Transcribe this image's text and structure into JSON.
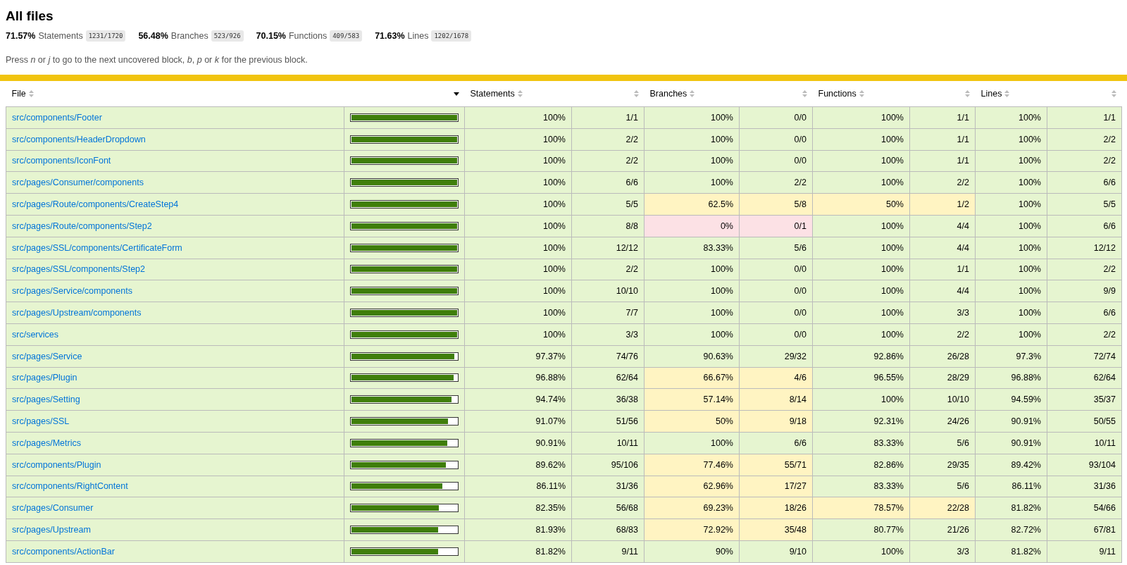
{
  "title": "All files",
  "summary": [
    {
      "pct": "71.57%",
      "label": "Statements",
      "fraction": "1231/1720"
    },
    {
      "pct": "56.48%",
      "label": "Branches",
      "fraction": "523/926"
    },
    {
      "pct": "70.15%",
      "label": "Functions",
      "fraction": "409/583"
    },
    {
      "pct": "71.63%",
      "label": "Lines",
      "fraction": "1202/1678"
    }
  ],
  "help": "Press *n* or *j* to go to the next uncovered block, *b*, *p* or *k* for the previous block.",
  "columns": [
    {
      "label": "File",
      "sorted": false
    },
    {
      "sorted": true
    },
    {
      "label": "Statements",
      "sorted": false
    },
    {
      "sorted": false
    },
    {
      "label": "Branches",
      "sorted": false
    },
    {
      "sorted": false
    },
    {
      "label": "Functions",
      "sorted": false
    },
    {
      "sorted": false
    },
    {
      "label": "Lines",
      "sorted": false
    },
    {
      "sorted": false
    }
  ],
  "rows": [
    {
      "file": "src/components/Footer",
      "level": 1,
      "statements": {
        "pct": "100%",
        "fraction": "1/1",
        "color": "#e6f5d0"
      },
      "branches": {
        "pct": "100%",
        "fraction": "0/0",
        "color": "#e6f5d0"
      },
      "functions": {
        "pct": "100%",
        "fraction": "1/1",
        "color": "#e6f5d0"
      },
      "lines": {
        "pct": "100%",
        "fraction": "1/1",
        "color": "#e6f5d0"
      }
    },
    {
      "file": "src/components/HeaderDropdown",
      "level": 1,
      "statements": {
        "pct": "100%",
        "fraction": "2/2",
        "color": "#e6f5d0"
      },
      "branches": {
        "pct": "100%",
        "fraction": "0/0",
        "color": "#e6f5d0"
      },
      "functions": {
        "pct": "100%",
        "fraction": "1/1",
        "color": "#e6f5d0"
      },
      "lines": {
        "pct": "100%",
        "fraction": "2/2",
        "color": "#e6f5d0"
      }
    },
    {
      "file": "src/components/IconFont",
      "level": 1,
      "statements": {
        "pct": "100%",
        "fraction": "2/2",
        "color": "#e6f5d0"
      },
      "branches": {
        "pct": "100%",
        "fraction": "0/0",
        "color": "#e6f5d0"
      },
      "functions": {
        "pct": "100%",
        "fraction": "1/1",
        "color": "#e6f5d0"
      },
      "lines": {
        "pct": "100%",
        "fraction": "2/2",
        "color": "#e6f5d0"
      }
    },
    {
      "file": "src/pages/Consumer/components",
      "level": 1,
      "statements": {
        "pct": "100%",
        "fraction": "6/6",
        "color": "#e6f5d0"
      },
      "branches": {
        "pct": "100%",
        "fraction": "2/2",
        "color": "#e6f5d0"
      },
      "functions": {
        "pct": "100%",
        "fraction": "2/2",
        "color": "#e6f5d0"
      },
      "lines": {
        "pct": "100%",
        "fraction": "6/6",
        "color": "#e6f5d0"
      }
    },
    {
      "file": "src/pages/Route/components/CreateStep4",
      "level": 1,
      "statements": {
        "pct": "100%",
        "fraction": "5/5",
        "color": "#e6f5d0"
      },
      "branches": {
        "pct": "62.5%",
        "fraction": "5/8",
        "color": "#fff4c2"
      },
      "functions": {
        "pct": "50%",
        "fraction": "1/2",
        "color": "#fff4c2"
      },
      "lines": {
        "pct": "100%",
        "fraction": "5/5",
        "color": "#e6f5d0"
      }
    },
    {
      "file": "src/pages/Route/components/Step2",
      "level": 1,
      "statements": {
        "pct": "100%",
        "fraction": "8/8",
        "color": "#e6f5d0"
      },
      "branches": {
        "pct": "0%",
        "fraction": "0/1",
        "color": "#fce1e5"
      },
      "functions": {
        "pct": "100%",
        "fraction": "4/4",
        "color": "#e6f5d0"
      },
      "lines": {
        "pct": "100%",
        "fraction": "6/6",
        "color": "#e6f5d0"
      }
    },
    {
      "file": "src/pages/SSL/components/CertificateForm",
      "level": 1,
      "statements": {
        "pct": "100%",
        "fraction": "12/12",
        "color": "#e6f5d0"
      },
      "branches": {
        "pct": "83.33%",
        "fraction": "5/6",
        "color": "#e6f5d0"
      },
      "functions": {
        "pct": "100%",
        "fraction": "4/4",
        "color": "#e6f5d0"
      },
      "lines": {
        "pct": "100%",
        "fraction": "12/12",
        "color": "#e6f5d0"
      }
    },
    {
      "file": "src/pages/SSL/components/Step2",
      "level": 1,
      "statements": {
        "pct": "100%",
        "fraction": "2/2",
        "color": "#e6f5d0"
      },
      "branches": {
        "pct": "100%",
        "fraction": "0/0",
        "color": "#e6f5d0"
      },
      "functions": {
        "pct": "100%",
        "fraction": "1/1",
        "color": "#e6f5d0"
      },
      "lines": {
        "pct": "100%",
        "fraction": "2/2",
        "color": "#e6f5d0"
      }
    },
    {
      "file": "src/pages/Service/components",
      "level": 1,
      "statements": {
        "pct": "100%",
        "fraction": "10/10",
        "color": "#e6f5d0"
      },
      "branches": {
        "pct": "100%",
        "fraction": "0/0",
        "color": "#e6f5d0"
      },
      "functions": {
        "pct": "100%",
        "fraction": "4/4",
        "color": "#e6f5d0"
      },
      "lines": {
        "pct": "100%",
        "fraction": "9/9",
        "color": "#e6f5d0"
      }
    },
    {
      "file": "src/pages/Upstream/components",
      "level": 1,
      "statements": {
        "pct": "100%",
        "fraction": "7/7",
        "color": "#e6f5d0"
      },
      "branches": {
        "pct": "100%",
        "fraction": "0/0",
        "color": "#e6f5d0"
      },
      "functions": {
        "pct": "100%",
        "fraction": "3/3",
        "color": "#e6f5d0"
      },
      "lines": {
        "pct": "100%",
        "fraction": "6/6",
        "color": "#e6f5d0"
      }
    },
    {
      "file": "src/services",
      "level": 1,
      "statements": {
        "pct": "100%",
        "fraction": "3/3",
        "color": "#e6f5d0"
      },
      "branches": {
        "pct": "100%",
        "fraction": "0/0",
        "color": "#e6f5d0"
      },
      "functions": {
        "pct": "100%",
        "fraction": "2/2",
        "color": "#e6f5d0"
      },
      "lines": {
        "pct": "100%",
        "fraction": "2/2",
        "color": "#e6f5d0"
      }
    },
    {
      "file": "src/pages/Service",
      "level": 0.9737,
      "statements": {
        "pct": "97.37%",
        "fraction": "74/76",
        "color": "#e6f5d0"
      },
      "branches": {
        "pct": "90.63%",
        "fraction": "29/32",
        "color": "#e6f5d0"
      },
      "functions": {
        "pct": "92.86%",
        "fraction": "26/28",
        "color": "#e6f5d0"
      },
      "lines": {
        "pct": "97.3%",
        "fraction": "72/74",
        "color": "#e6f5d0"
      }
    },
    {
      "file": "src/pages/Plugin",
      "level": 0.9688,
      "statements": {
        "pct": "96.88%",
        "fraction": "62/64",
        "color": "#e6f5d0"
      },
      "branches": {
        "pct": "66.67%",
        "fraction": "4/6",
        "color": "#fff4c2"
      },
      "functions": {
        "pct": "96.55%",
        "fraction": "28/29",
        "color": "#e6f5d0"
      },
      "lines": {
        "pct": "96.88%",
        "fraction": "62/64",
        "color": "#e6f5d0"
      }
    },
    {
      "file": "src/pages/Setting",
      "level": 0.9474,
      "statements": {
        "pct": "94.74%",
        "fraction": "36/38",
        "color": "#e6f5d0"
      },
      "branches": {
        "pct": "57.14%",
        "fraction": "8/14",
        "color": "#fff4c2"
      },
      "functions": {
        "pct": "100%",
        "fraction": "10/10",
        "color": "#e6f5d0"
      },
      "lines": {
        "pct": "94.59%",
        "fraction": "35/37",
        "color": "#e6f5d0"
      }
    },
    {
      "file": "src/pages/SSL",
      "level": 0.9107,
      "statements": {
        "pct": "91.07%",
        "fraction": "51/56",
        "color": "#e6f5d0"
      },
      "branches": {
        "pct": "50%",
        "fraction": "9/18",
        "color": "#fff4c2"
      },
      "functions": {
        "pct": "92.31%",
        "fraction": "24/26",
        "color": "#e6f5d0"
      },
      "lines": {
        "pct": "90.91%",
        "fraction": "50/55",
        "color": "#e6f5d0"
      }
    },
    {
      "file": "src/pages/Metrics",
      "level": 0.9091,
      "statements": {
        "pct": "90.91%",
        "fraction": "10/11",
        "color": "#e6f5d0"
      },
      "branches": {
        "pct": "100%",
        "fraction": "6/6",
        "color": "#e6f5d0"
      },
      "functions": {
        "pct": "83.33%",
        "fraction": "5/6",
        "color": "#e6f5d0"
      },
      "lines": {
        "pct": "90.91%",
        "fraction": "10/11",
        "color": "#e6f5d0"
      }
    },
    {
      "file": "src/components/Plugin",
      "level": 0.8962,
      "statements": {
        "pct": "89.62%",
        "fraction": "95/106",
        "color": "#e6f5d0"
      },
      "branches": {
        "pct": "77.46%",
        "fraction": "55/71",
        "color": "#fff4c2"
      },
      "functions": {
        "pct": "82.86%",
        "fraction": "29/35",
        "color": "#e6f5d0"
      },
      "lines": {
        "pct": "89.42%",
        "fraction": "93/104",
        "color": "#e6f5d0"
      }
    },
    {
      "file": "src/components/RightContent",
      "level": 0.8611,
      "statements": {
        "pct": "86.11%",
        "fraction": "31/36",
        "color": "#e6f5d0"
      },
      "branches": {
        "pct": "62.96%",
        "fraction": "17/27",
        "color": "#fff4c2"
      },
      "functions": {
        "pct": "83.33%",
        "fraction": "5/6",
        "color": "#e6f5d0"
      },
      "lines": {
        "pct": "86.11%",
        "fraction": "31/36",
        "color": "#e6f5d0"
      }
    },
    {
      "file": "src/pages/Consumer",
      "level": 0.8235,
      "statements": {
        "pct": "82.35%",
        "fraction": "56/68",
        "color": "#e6f5d0"
      },
      "branches": {
        "pct": "69.23%",
        "fraction": "18/26",
        "color": "#fff4c2"
      },
      "functions": {
        "pct": "78.57%",
        "fraction": "22/28",
        "color": "#fff4c2"
      },
      "lines": {
        "pct": "81.82%",
        "fraction": "54/66",
        "color": "#e6f5d0"
      }
    },
    {
      "file": "src/pages/Upstream",
      "level": 0.8193,
      "statements": {
        "pct": "81.93%",
        "fraction": "68/83",
        "color": "#e6f5d0"
      },
      "branches": {
        "pct": "72.92%",
        "fraction": "35/48",
        "color": "#fff4c2"
      },
      "functions": {
        "pct": "80.77%",
        "fraction": "21/26",
        "color": "#e6f5d0"
      },
      "lines": {
        "pct": "82.72%",
        "fraction": "67/81",
        "color": "#e6f5d0"
      }
    },
    {
      "file": "src/components/ActionBar",
      "level": 0.8182,
      "statements": {
        "pct": "81.82%",
        "fraction": "9/11",
        "color": "#e6f5d0"
      },
      "branches": {
        "pct": "90%",
        "fraction": "9/10",
        "color": "#e6f5d0"
      },
      "functions": {
        "pct": "100%",
        "fraction": "3/3",
        "color": "#e6f5d0"
      },
      "lines": {
        "pct": "81.82%",
        "fraction": "9/11",
        "color": "#e6f5d0"
      }
    }
  ]
}
